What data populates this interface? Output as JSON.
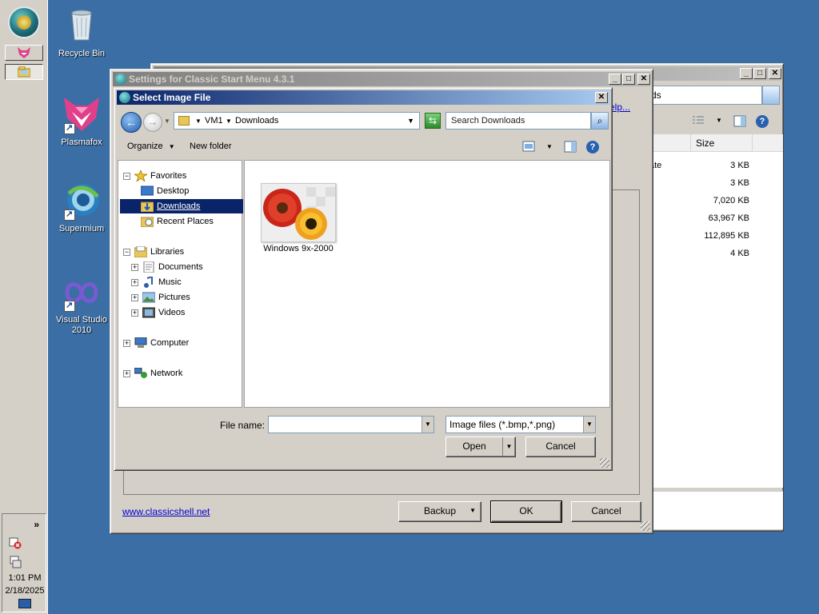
{
  "desktop": {
    "icons": [
      {
        "label": "Recycle Bin"
      },
      {
        "label": "Plasmafox"
      },
      {
        "label": "Supermium"
      },
      {
        "label": "Visual Studio 2010"
      }
    ]
  },
  "taskbar": {
    "tray_chevron": "»",
    "clock_time": "1:01 PM",
    "clock_date": "2/18/2025"
  },
  "explorer": {
    "search_fragment": "ds",
    "column_size": "Size",
    "rows": [
      {
        "name": "ficate",
        "size": "3 KB"
      },
      {
        "name": "",
        "size": "3 KB"
      },
      {
        "name": "",
        "size": "7,020 KB"
      },
      {
        "name": "",
        "size": "63,967 KB"
      },
      {
        "name": "",
        "size": "112,895 KB"
      },
      {
        "name": "",
        "size": "4 KB"
      }
    ]
  },
  "settings": {
    "title": "Settings for Classic Start Menu 4.3.1",
    "help_fragment": "elp...",
    "link": "www.classicshell.net",
    "backup_label": "Backup",
    "ok_label": "OK",
    "cancel_label": "Cancel"
  },
  "dialog": {
    "title": "Select Image File",
    "breadcrumb": [
      "VM1",
      "Downloads"
    ],
    "search_placeholder": "Search Downloads",
    "organize_label": "Organize",
    "new_folder_label": "New folder",
    "tree": {
      "favorites": "Favorites",
      "desktop": "Desktop",
      "downloads": "Downloads",
      "recent": "Recent Places",
      "libraries": "Libraries",
      "documents": "Documents",
      "music": "Music",
      "pictures": "Pictures",
      "videos": "Videos",
      "computer": "Computer",
      "network": "Network"
    },
    "file_item": "Windows 9x-2000",
    "file_name_label": "File name:",
    "file_name_value": "",
    "file_type": "Image files (*.bmp,*.png)",
    "open_label": "Open",
    "cancel_label": "Cancel"
  },
  "colors": {
    "desktop_bg": "#3a6ea5",
    "active_title_start": "#0a246a",
    "active_title_end": "#a6caf0",
    "selection": "#0a246a"
  }
}
